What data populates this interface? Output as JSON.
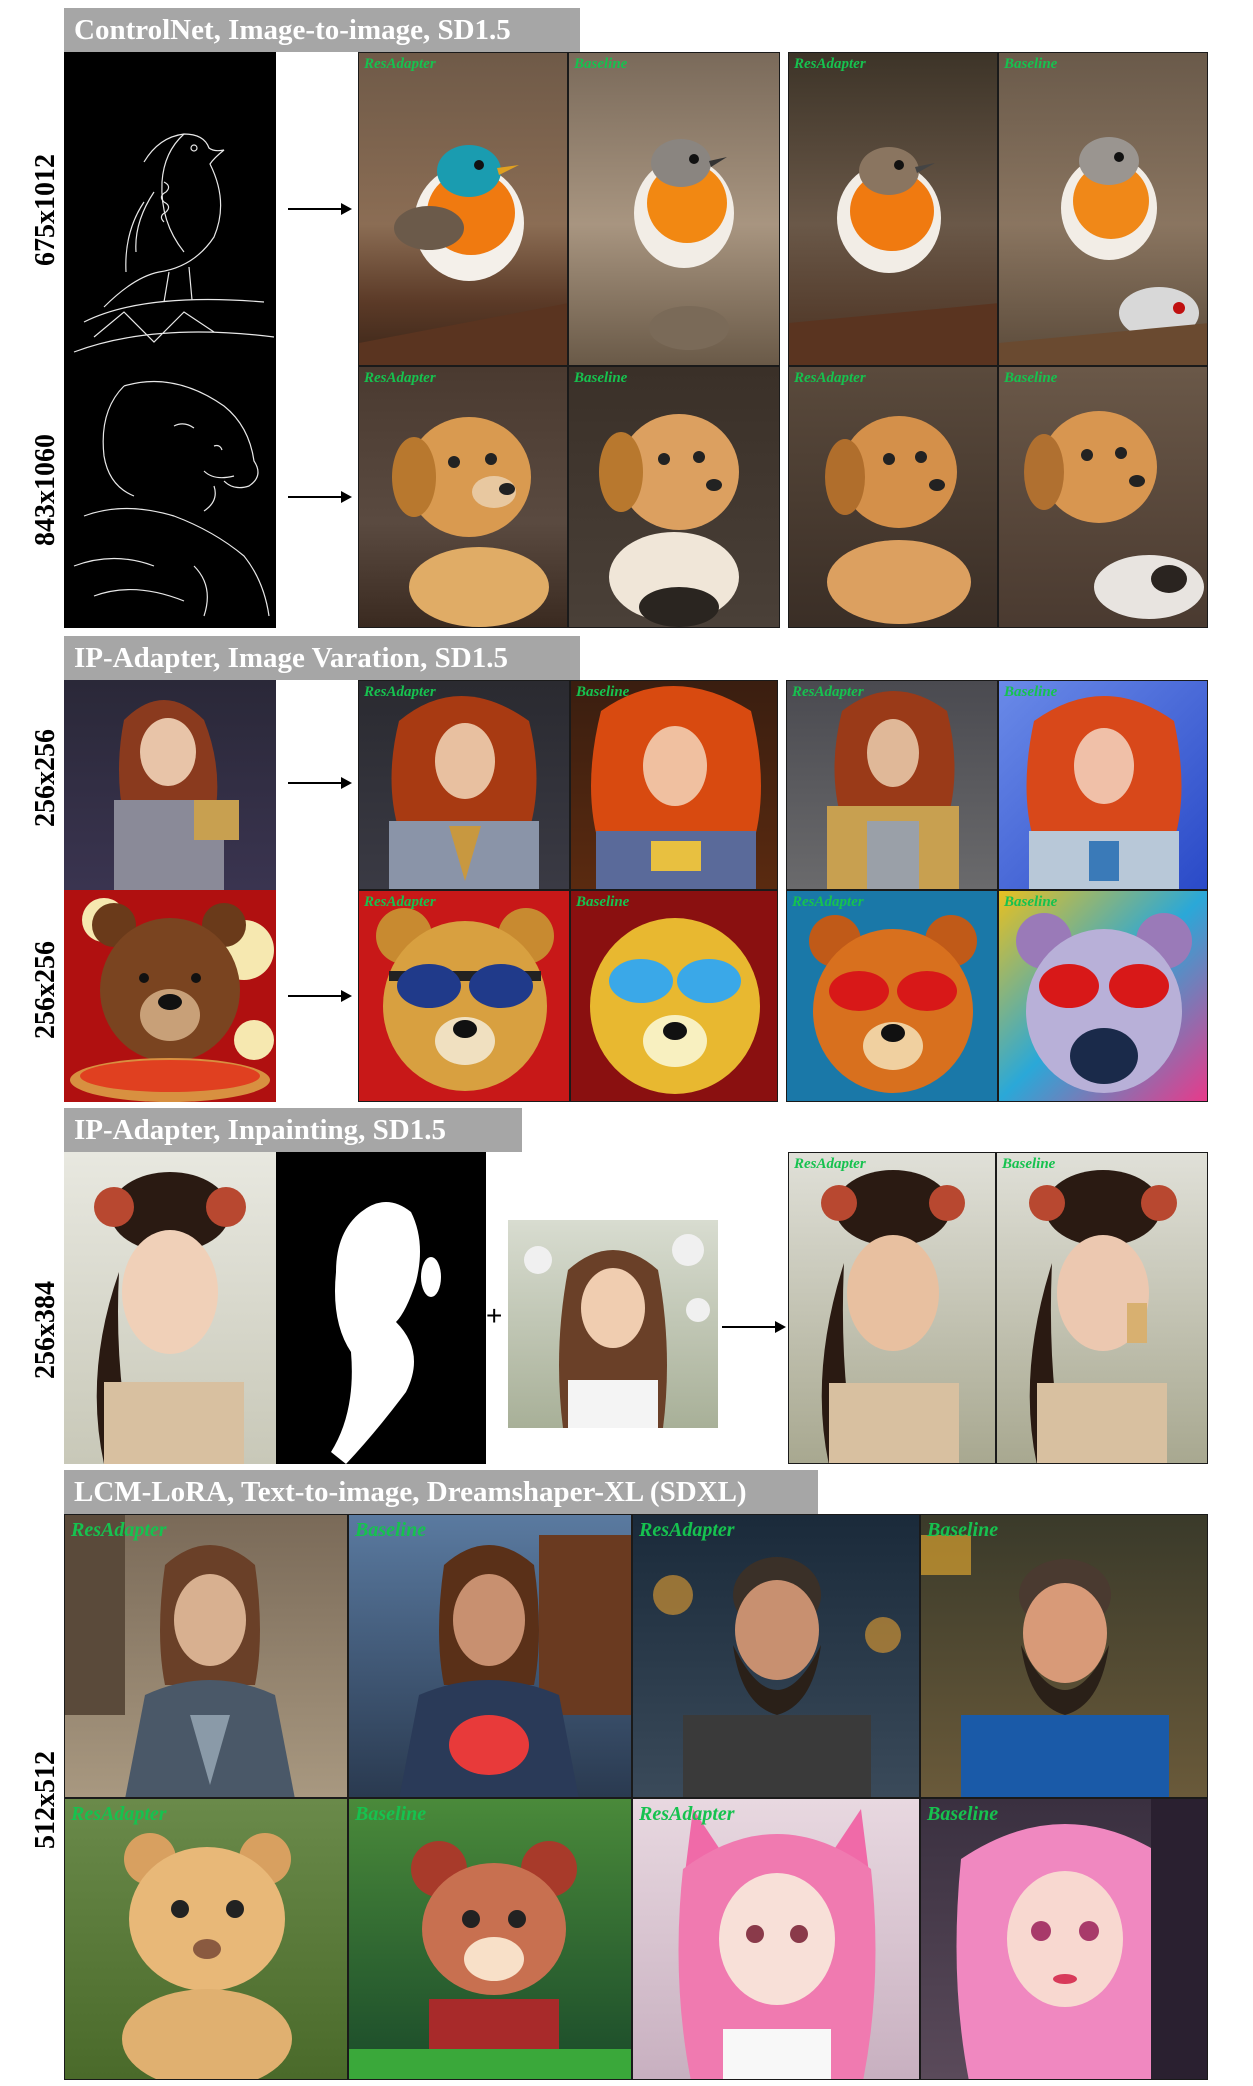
{
  "sections": {
    "controlnet": {
      "title": "ControlNet, Image-to-image, SD1.5",
      "rows": [
        "675x1012",
        "843x1060"
      ]
    },
    "ipadapter_variation": {
      "title": "IP-Adapter, Image Varation, SD1.5",
      "rows": [
        "256x256",
        "256x256"
      ]
    },
    "ipadapter_inpainting": {
      "title": "IP-Adapter, Inpainting, SD1.5",
      "rows": [
        "256x384"
      ],
      "plus": "+"
    },
    "lcm_lora": {
      "title": "LCM-LoRA, Text-to-image, Dreamshaper-XL (SDXL)",
      "rows": [
        "512x512"
      ]
    }
  },
  "tags": {
    "resadapter": "ResAdapter",
    "baseline": "Baseline"
  }
}
